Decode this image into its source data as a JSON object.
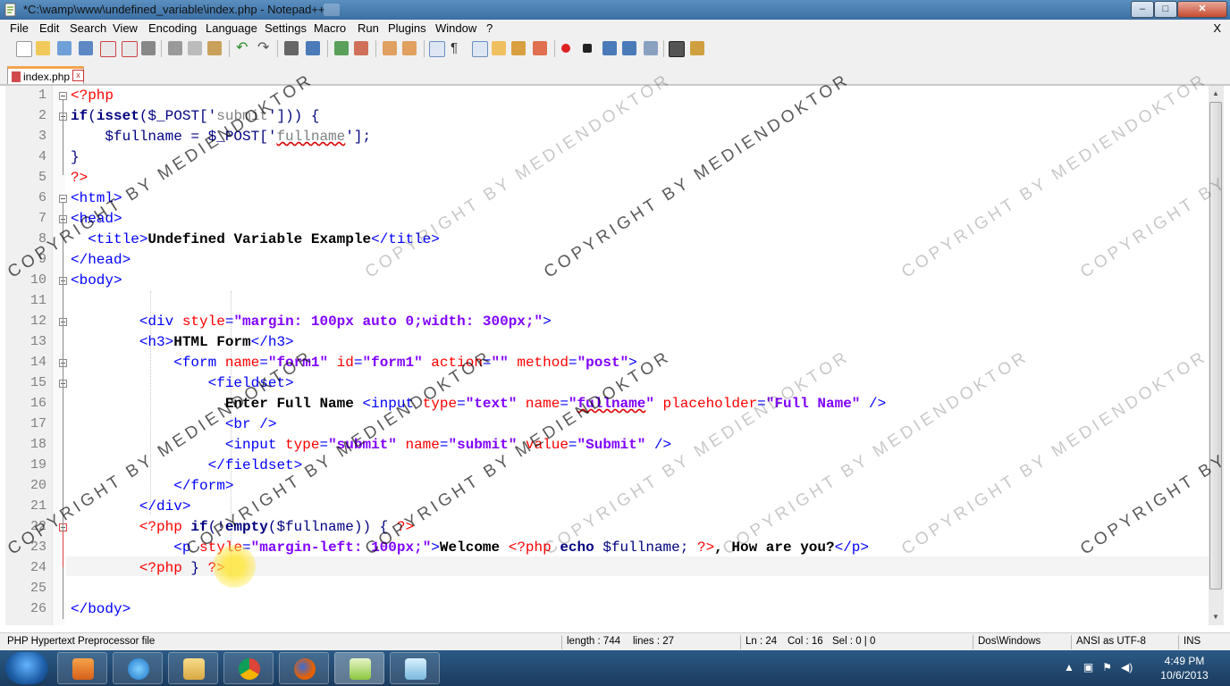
{
  "window": {
    "title": "*C:\\wamp\\www\\undefined_variable\\index.php - Notepad++",
    "minimize": "–",
    "maximize": "□",
    "close": "✕"
  },
  "menubar": {
    "items": [
      "File",
      "Edit",
      "Search",
      "View",
      "Encoding",
      "Language",
      "Settings",
      "Macro",
      "Run",
      "Plugins",
      "Window",
      "?"
    ],
    "close_doc": "X"
  },
  "tabs": [
    {
      "label": "index.php",
      "close": "x"
    }
  ],
  "editor": {
    "line_numbers": [
      "1",
      "2",
      "3",
      "4",
      "5",
      "6",
      "7",
      "8",
      "9",
      "10",
      "11",
      "12",
      "13",
      "14",
      "15",
      "16",
      "17",
      "18",
      "19",
      "20",
      "21",
      "22",
      "23",
      "24",
      "25",
      "26"
    ],
    "current_line": "24",
    "lines": {
      "l1": [
        "<?php"
      ],
      "l2": [
        "if",
        "(",
        "isset",
        "($_POST['",
        "submit",
        "']))",
        " {"
      ],
      "l3": [
        "    $fullname = $_POST['",
        "fullname",
        "'];"
      ],
      "l4": [
        "}"
      ],
      "l5": [
        "?>"
      ],
      "l6": [
        "<html>"
      ],
      "l7": [
        "<head>"
      ],
      "l8": [
        "  <title>",
        "Undefined Variable Example",
        "</title>"
      ],
      "l9": [
        "</head>"
      ],
      "l10": [
        "<body>"
      ],
      "l12": [
        "        <div ",
        "style",
        "=",
        "\"margin: 100px auto 0;width: 300px;\"",
        ">"
      ],
      "l13": [
        "        <h3>",
        "HTML Form",
        "</h3>"
      ],
      "l14": [
        "            <form ",
        "name",
        "=",
        "\"form1\"",
        " id",
        "=",
        "\"form1\"",
        " action",
        "=",
        "\"\"",
        " method",
        "=",
        "\"post\"",
        ">"
      ],
      "l15": [
        "                <fieldset>"
      ],
      "l16": [
        "                  Enter Full Name ",
        "<input ",
        "type",
        "=",
        "\"text\"",
        " name",
        "=",
        "\"",
        "fullname",
        "\"",
        " placeholder",
        "=",
        "\"Full Name\"",
        " />"
      ],
      "l17": [
        "                  <br />"
      ],
      "l18": [
        "                  <input ",
        "type",
        "=",
        "\"submit\"",
        " name",
        "=",
        "\"submit\"",
        " value",
        "=",
        "\"Submit\"",
        " />"
      ],
      "l19": [
        "                </fieldset>"
      ],
      "l20": [
        "            </form>"
      ],
      "l21": [
        "        </div>"
      ],
      "l22": [
        "        <?php ",
        "if",
        "(!",
        "empty",
        "($fullname)) { ",
        "?>"
      ],
      "l23": [
        "            <p ",
        "style",
        "=",
        "\"margin-left: 100px;\"",
        ">",
        "Welcome ",
        "<?php ",
        "echo ",
        "$fullname; ",
        "?>",
        ", How are you?",
        "</p>"
      ],
      "l24": [
        "        <?php ",
        "} ",
        "?>"
      ],
      "l26": [
        "</body>"
      ]
    }
  },
  "statusbar": {
    "filetype": "PHP Hypertext Preprocessor file",
    "length": "length : 744",
    "lines": "lines : 27",
    "ln": "Ln : 24",
    "col": "Col : 16",
    "sel": "Sel : 0 | 0",
    "eol": "Dos\\Windows",
    "encoding": "ANSI as UTF-8",
    "mode": "INS"
  },
  "taskbar": {
    "time": "4:49 PM",
    "date": "10/6/2013",
    "apps": [
      "media-player",
      "internet-explorer",
      "file-explorer",
      "chrome",
      "firefox",
      "notepad-plus-plus",
      "notepad"
    ]
  },
  "watermark": "COPYRIGHT BY MEDIENDOKTOR"
}
